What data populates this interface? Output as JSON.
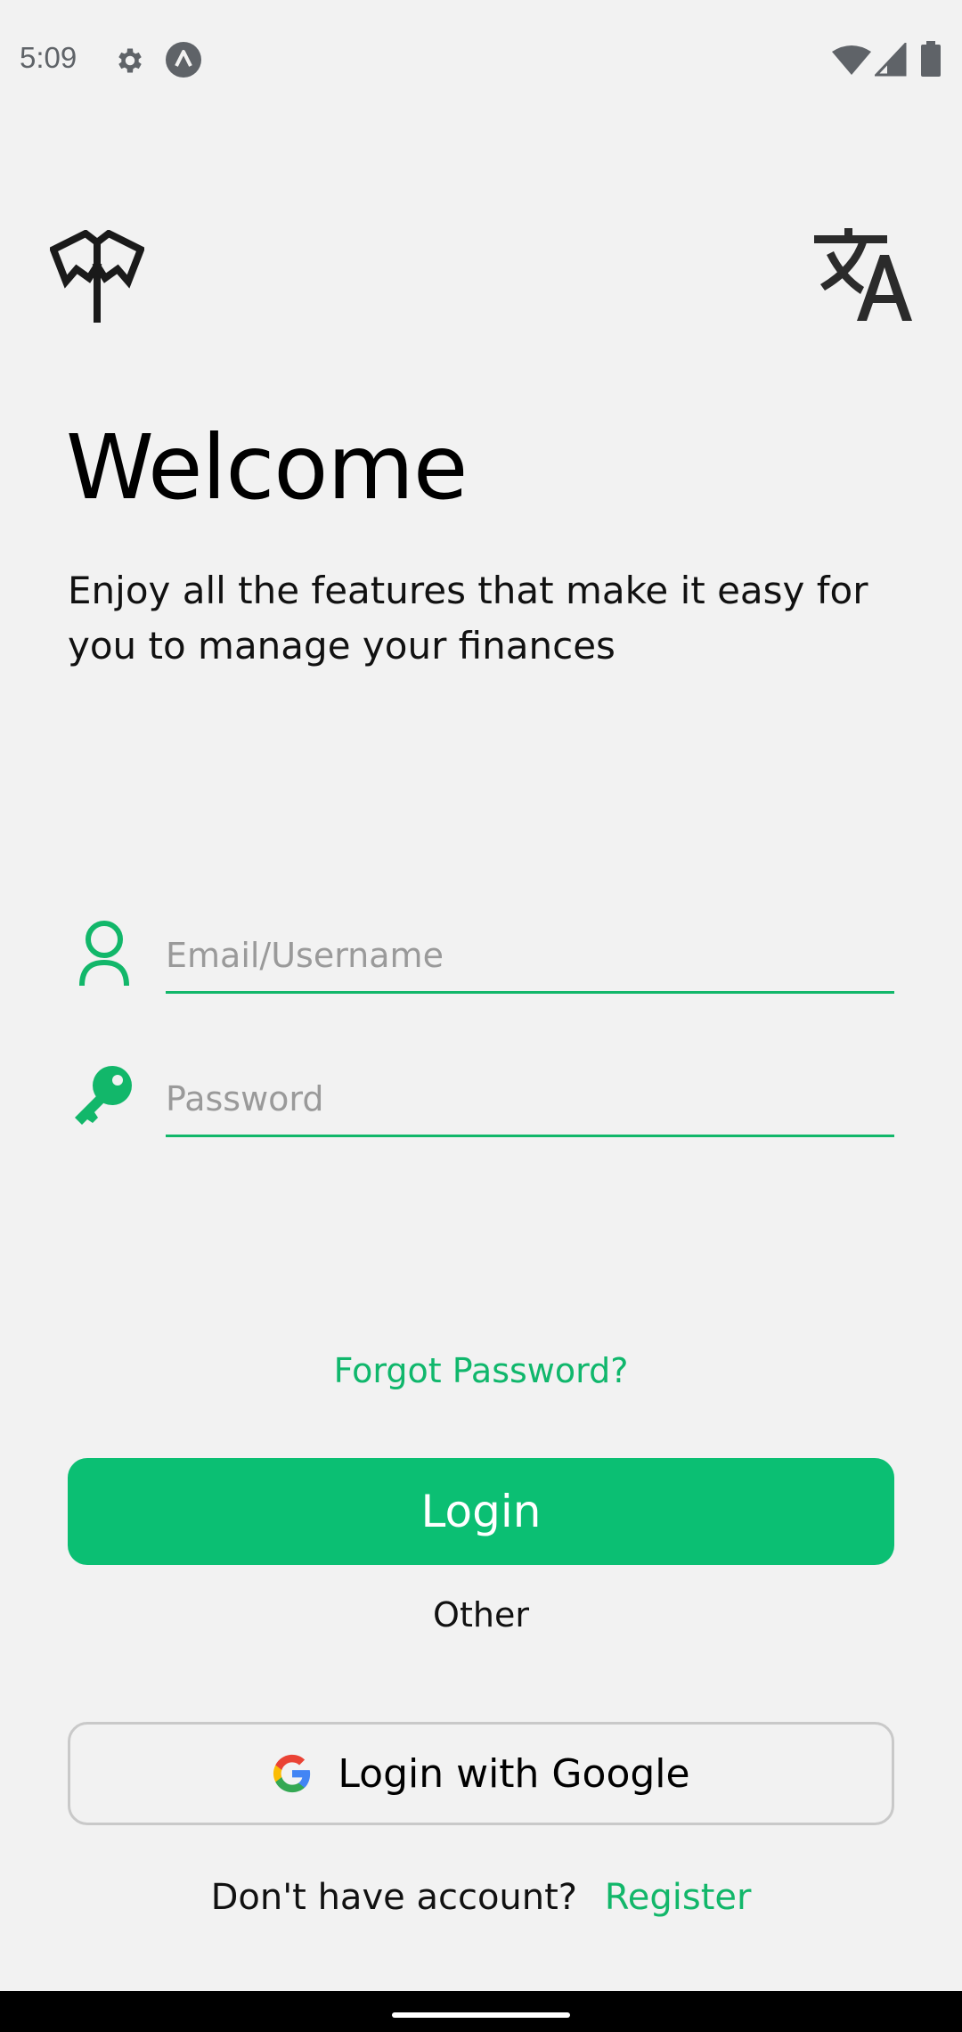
{
  "status_bar": {
    "time": "5:09",
    "icons": [
      "settings-icon",
      "app-notification-icon",
      "wifi-icon",
      "signal-icon",
      "battery-icon"
    ]
  },
  "header": {
    "logo_icon": "butterfly-logo-icon",
    "translate_icon": "translate-icon"
  },
  "welcome": {
    "title": "Welcome",
    "subtitle": "Enjoy all the features that make it easy for you to manage your finances"
  },
  "form": {
    "username": {
      "placeholder": "Email/Username",
      "value": "",
      "icon": "user-icon"
    },
    "password": {
      "placeholder": "Password",
      "value": "",
      "icon": "key-icon"
    },
    "forgot_password": "Forgot Password?",
    "login_label": "Login",
    "other_label": "Other",
    "google_label": "Login with Google",
    "google_icon": "google-icon",
    "no_account_text": "Don't have account?",
    "register_label": "Register"
  },
  "colors": {
    "accent": "#0bbf73",
    "link": "#10b76c",
    "background": "#f2f2f2"
  }
}
